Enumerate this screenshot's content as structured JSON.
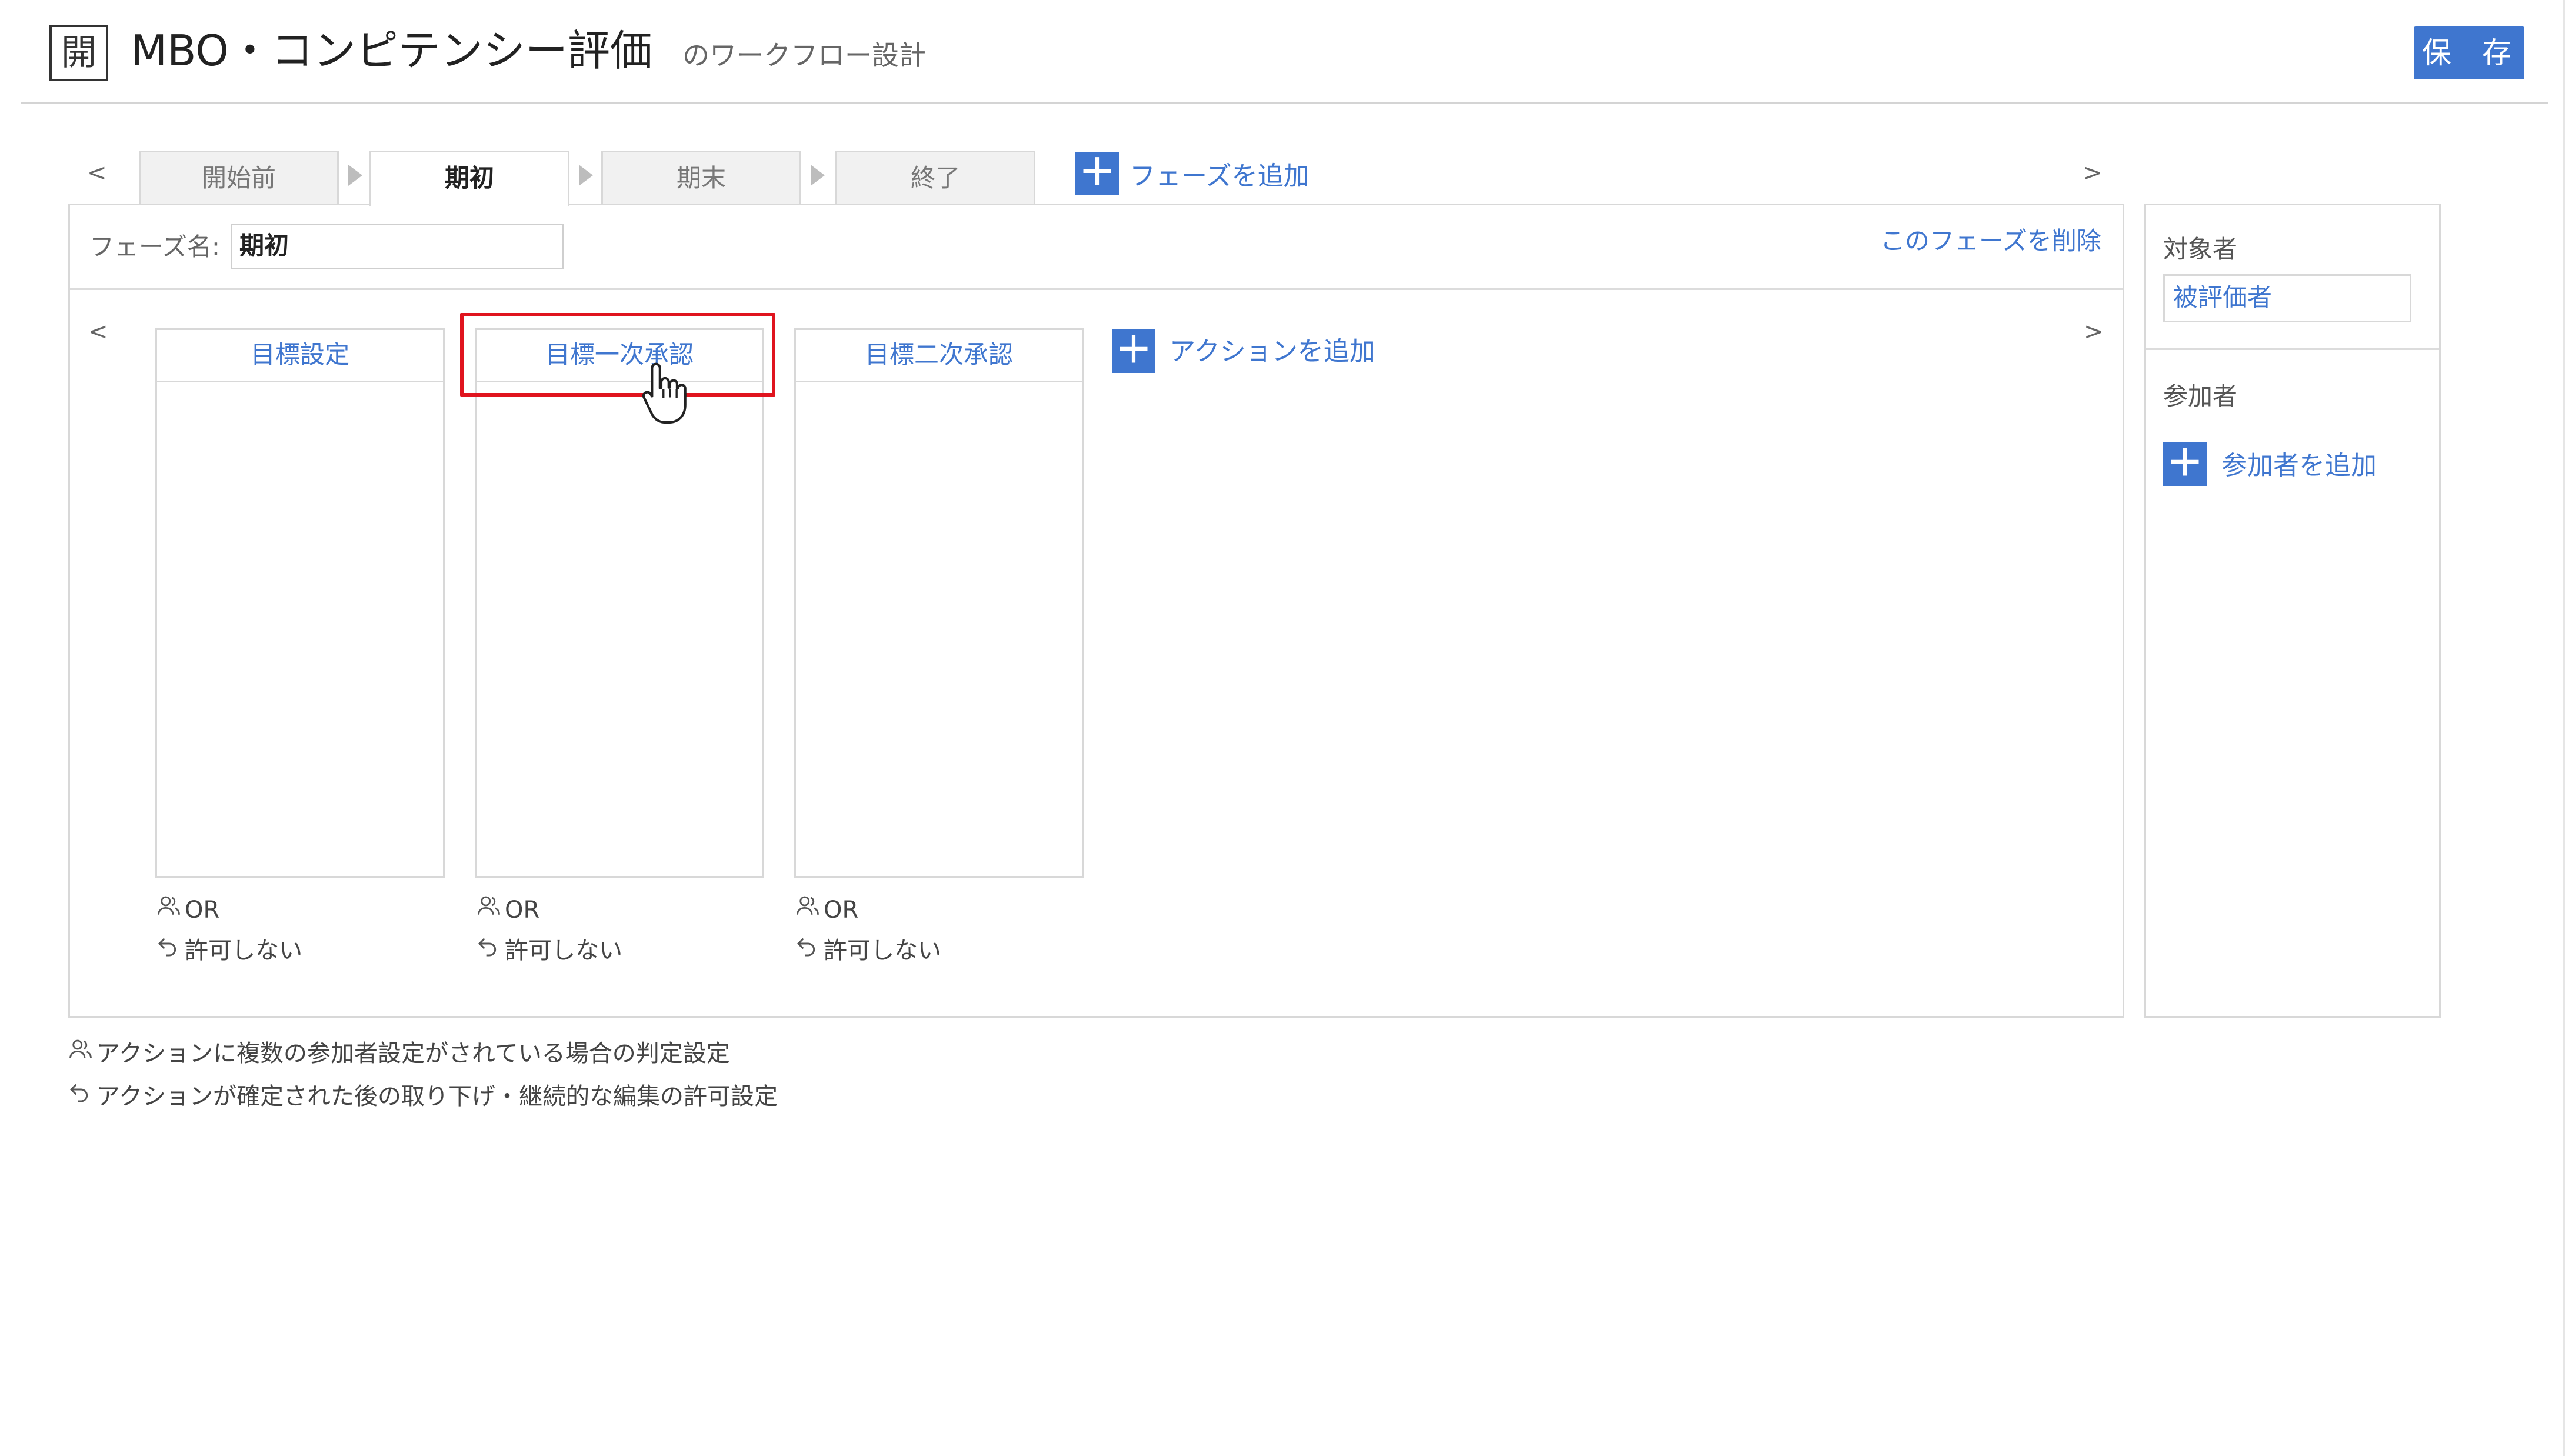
{
  "header": {
    "app_icon_char": "開",
    "title": "MBO・コンピテンシー評価",
    "subtitle": "のワークフロー設計",
    "save_label": "保 存"
  },
  "phase_nav": {
    "prev": "<",
    "next": ">",
    "tabs": [
      {
        "label": "開始前",
        "active": false
      },
      {
        "label": "期初",
        "active": true
      },
      {
        "label": "期末",
        "active": false
      },
      {
        "label": "終了",
        "active": false
      }
    ],
    "add_phase_label": "フェーズを追加"
  },
  "phase": {
    "name_label": "フェーズ名:",
    "name_value": "期初",
    "delete_label": "このフェーズを削除"
  },
  "actions_nav": {
    "prev": "<",
    "next": ">"
  },
  "actions": [
    {
      "title": "目標設定",
      "judgement": "OR",
      "permission": "許可しない"
    },
    {
      "title": "目標一次承認",
      "judgement": "OR",
      "permission": "許可しない"
    },
    {
      "title": "目標二次承認",
      "judgement": "OR",
      "permission": "許可しない"
    }
  ],
  "add_action_label": "アクションを追加",
  "side_panel": {
    "target_label": "対象者",
    "target_value": "被評価者",
    "participants_label": "参加者",
    "add_participant_label": "参加者を追加"
  },
  "legend": {
    "judgement": "アクションに複数の参加者設定がされている場合の判定設定",
    "permission": "アクションが確定された後の取り下げ・継続的な編集の許可設定"
  },
  "colors": {
    "accent": "#3f76cf",
    "highlight": "#e0141e"
  },
  "icons": {
    "plus": "＋",
    "users": "users-icon",
    "undo": "undo-icon",
    "cursor": "hand-pointer-icon"
  }
}
